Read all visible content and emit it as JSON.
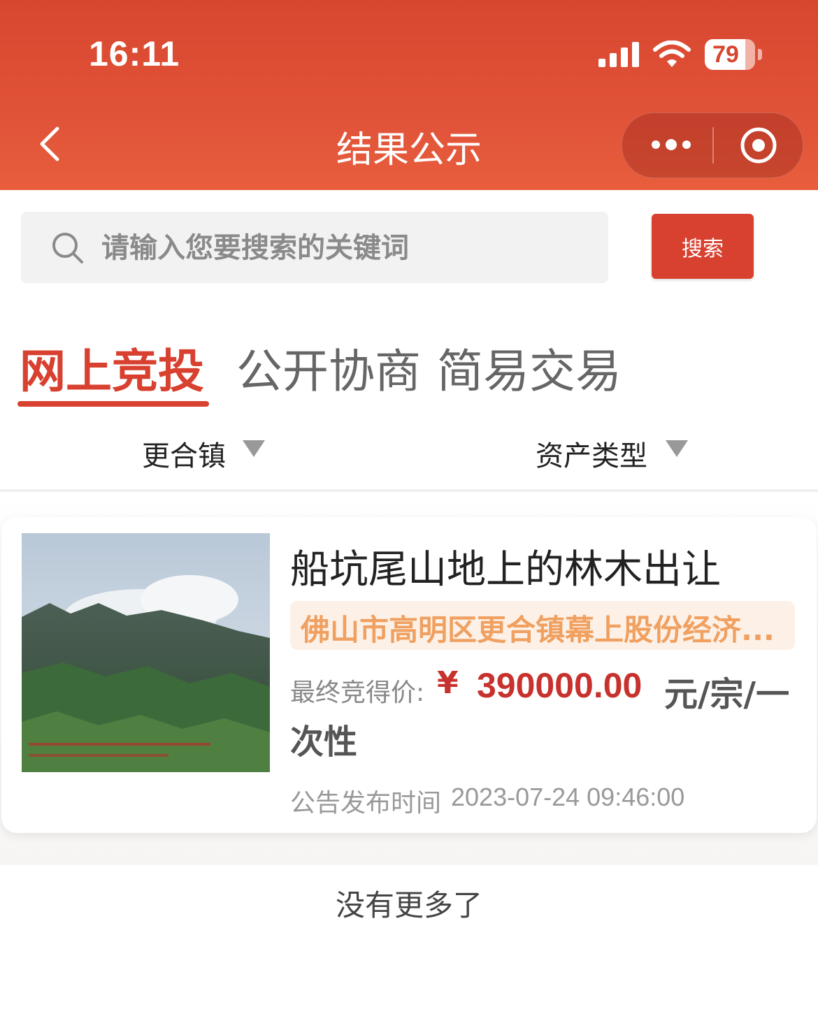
{
  "status_bar": {
    "time": "16:11",
    "battery": "79"
  },
  "nav": {
    "title": "结果公示"
  },
  "search": {
    "placeholder": "请输入您要搜索的关键词",
    "button_label": "搜索"
  },
  "tabs": [
    {
      "label": "网上竞投",
      "active": true
    },
    {
      "label": "公开协商",
      "active": false
    },
    {
      "label": "简易交易",
      "active": false
    }
  ],
  "filters": {
    "town": "更合镇",
    "asset_type": "资产类型"
  },
  "listing": {
    "title": "船坑尾山地上的林木出让",
    "org": "佛山市高明区更合镇幕上股份经济...",
    "price_label": "最终竞得价:",
    "currency": "¥",
    "price": "390000.00",
    "unit_line1": "元/宗/一",
    "unit_line2": "次性",
    "publish_label": "公告发布时间",
    "publish_time": "2023-07-24 09:46:00"
  },
  "footer": {
    "no_more": "没有更多了"
  },
  "colors": {
    "brand": "#d8462f",
    "price": "#c8322e",
    "org_text": "#f0a060",
    "org_bg": "#fdf1e7"
  }
}
